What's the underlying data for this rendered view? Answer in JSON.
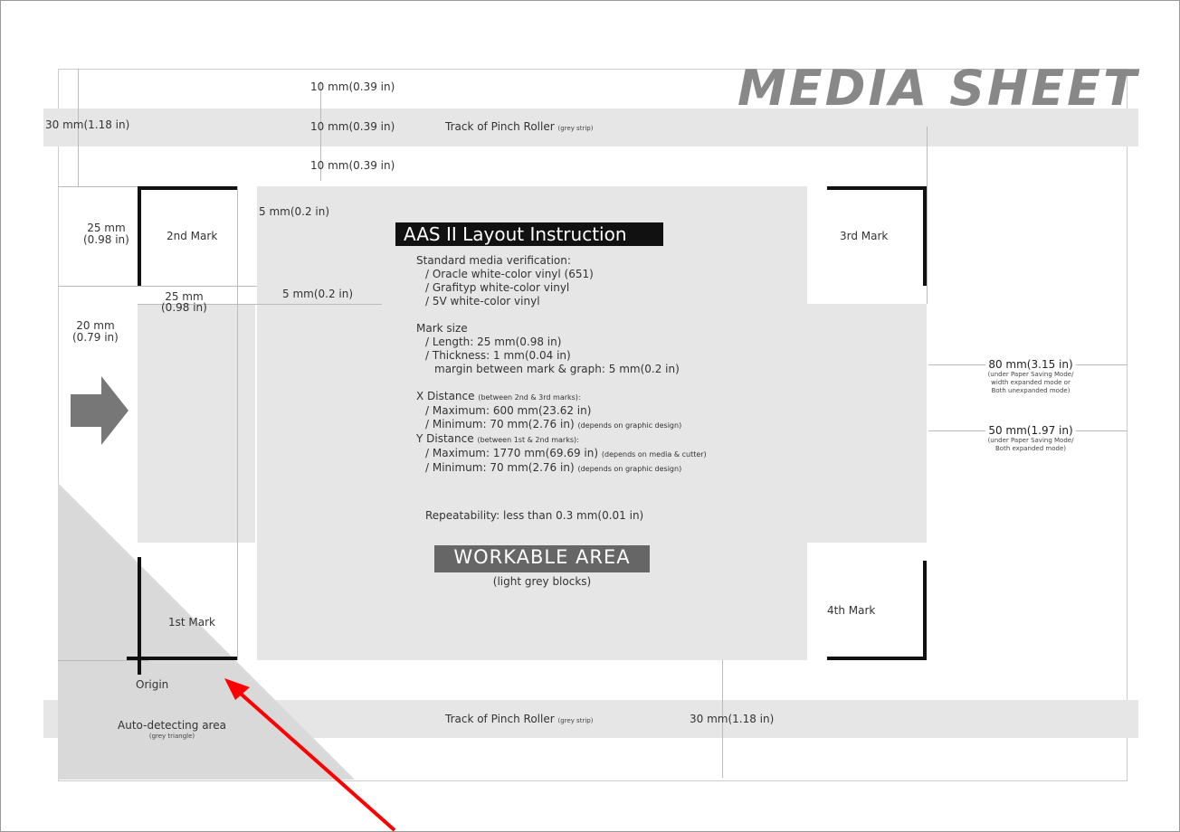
{
  "title": "MEDIA SHEET",
  "top_dims": {
    "d1": "10 mm(0.39 in)",
    "d2": "10 mm(0.39 in)",
    "d3": "10 mm(0.39 in)",
    "left_margin": "30 mm(1.18 in)"
  },
  "pinch_roller": {
    "label": "Track of Pinch Roller",
    "note": "(grey strip)"
  },
  "marks": {
    "second": "2nd Mark",
    "third": "3rd Mark",
    "first": "1st Mark",
    "fourth": "4th Mark"
  },
  "left_dims": {
    "mark_height": "25 mm",
    "mark_height_in": "(0.98 in)",
    "gap_top": "5 mm(0.2 in)",
    "mark_width": "25 mm",
    "mark_width_in": "(0.98 in)",
    "gap_side": "5 mm(0.2 in)",
    "edge": "20 mm",
    "edge_in": "(0.79 in)"
  },
  "instruction": {
    "heading": "AAS II Layout Instruction",
    "verification_title": "Standard media verification:",
    "verification_items": [
      "/ Oracle white-color vinyl (651)",
      "/ Grafityp white-color vinyl",
      "/ 5V white-color vinyl"
    ],
    "mark_size_title": "Mark size",
    "mark_size_items": [
      "/ Length: 25 mm(0.98 in)",
      "/ Thickness: 1 mm(0.04 in)",
      "margin between mark & graph: 5 mm(0.2 in)"
    ],
    "x_title": "X Distance",
    "x_note": "(between 2nd & 3rd marks):",
    "x_max": "/ Maximum: 600 mm(23.62 in)",
    "x_min": "/ Minimum:  70 mm(2.76 in)",
    "x_min_note": "(depends on graphic design)",
    "y_title": "Y Distance",
    "y_note": "(between 1st & 2nd marks):",
    "y_max": "/ Maximum: 1770 mm(69.69 in)",
    "y_max_note": "(depends on media & cutter)",
    "y_min": "/ Minimum:  70 mm(2.76 in)",
    "y_min_note": "(depends on graphic design)",
    "repeatability": "Repeatability: less than 0.3 mm(0.01 in)"
  },
  "workable": {
    "label": "WORKABLE AREA",
    "note": "(light grey blocks)"
  },
  "right_dims": {
    "d80": "80 mm(3.15 in)",
    "d80_note1": "(under Paper Saving Mode/",
    "d80_note2": "width expanded mode or",
    "d80_note3": "Both unexpanded mode)",
    "d50": "50 mm(1.97 in)",
    "d50_note1": "(under Paper Saving Mode/",
    "d50_note2": "Both expanded mode)"
  },
  "bottom": {
    "origin": "Origin",
    "auto_detect": "Auto-detecting area",
    "auto_detect_note": "(grey triangle)",
    "bottom_margin": "30 mm(1.18 in)"
  },
  "colors": {
    "accent_arrow": "#ff0000",
    "strip": "#e6e6e6",
    "area": "#e6e6e6",
    "title": "#888888"
  }
}
